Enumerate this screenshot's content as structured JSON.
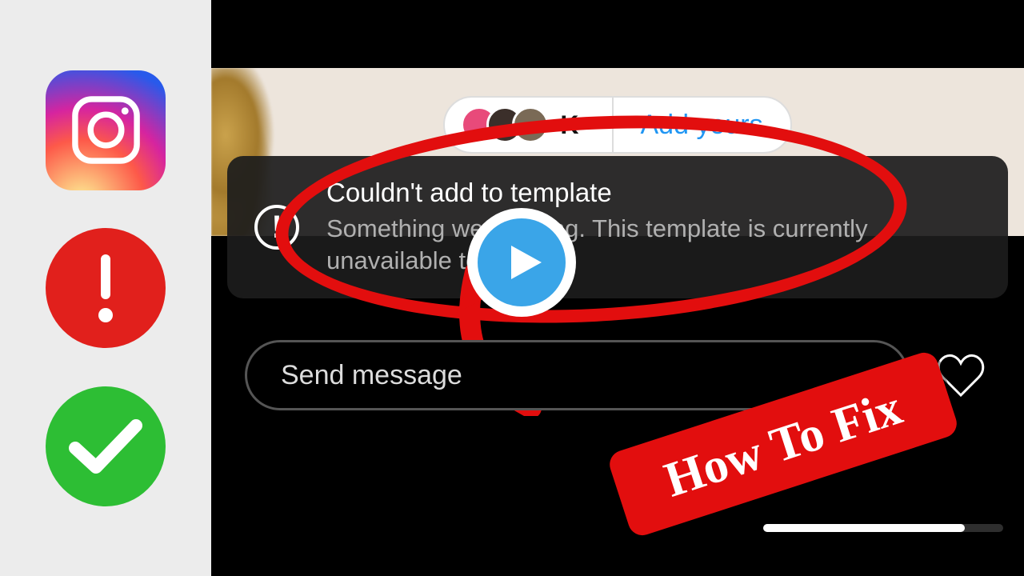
{
  "sidebar": {
    "icons": [
      "instagram-logo",
      "alert-icon",
      "check-icon"
    ]
  },
  "card": {
    "viewer_count_label": "K",
    "add_yours_label": "Add yours"
  },
  "toast": {
    "title": "Couldn't add to template",
    "body": "Something went wrong. This template is currently unavailable to add to."
  },
  "input": {
    "placeholder": "Send message"
  },
  "annotation": {
    "label": "How To Fix"
  },
  "colors": {
    "accent_red": "#e20e0e",
    "play_blue": "#3aa5e8",
    "link_blue": "#2196f3",
    "success_green": "#2dbe34"
  }
}
